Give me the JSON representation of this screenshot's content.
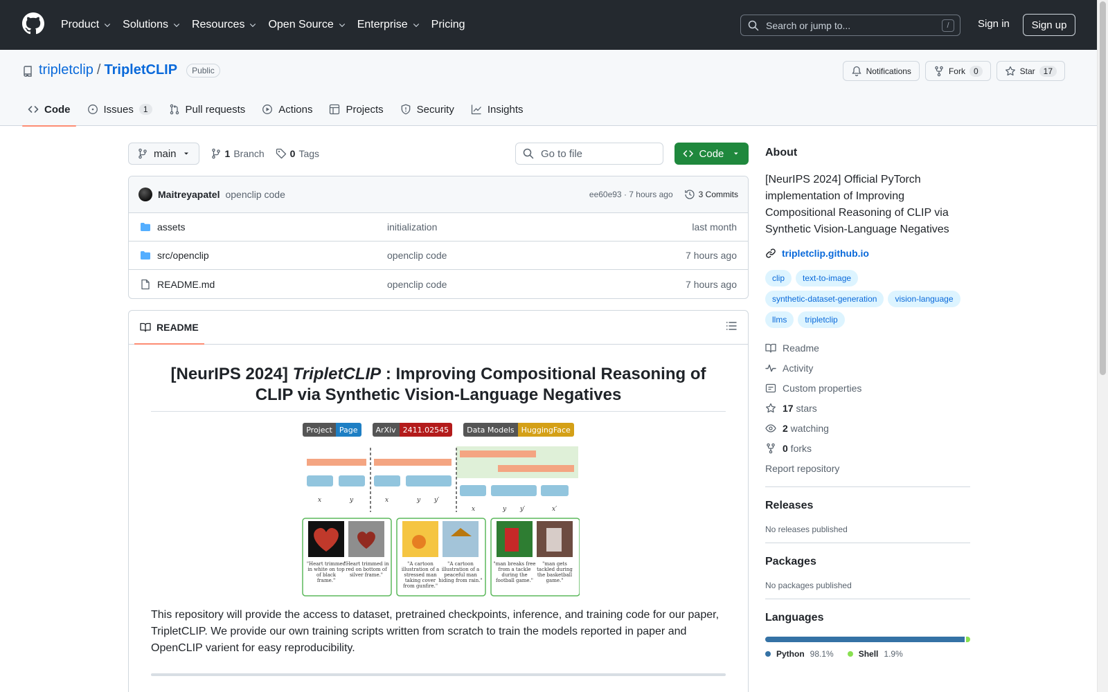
{
  "header": {
    "nav": [
      {
        "label": "Product",
        "dropdown": true
      },
      {
        "label": "Solutions",
        "dropdown": true
      },
      {
        "label": "Resources",
        "dropdown": true
      },
      {
        "label": "Open Source",
        "dropdown": true
      },
      {
        "label": "Enterprise",
        "dropdown": true
      },
      {
        "label": "Pricing",
        "dropdown": false
      }
    ],
    "search_placeholder": "Search or jump to...",
    "search_shortcut": "/",
    "sign_in": "Sign in",
    "sign_up": "Sign up"
  },
  "repo": {
    "owner": "tripletclip",
    "separator": "/",
    "name": "TripletCLIP",
    "visibility": "Public",
    "notifications_label": "Notifications",
    "fork_label": "Fork",
    "fork_count": "0",
    "star_label": "Star",
    "star_count": "17",
    "tabs": [
      {
        "label": "Code",
        "icon": "code-icon",
        "active": true,
        "count": ""
      },
      {
        "label": "Issues",
        "icon": "issue-icon",
        "active": false,
        "count": "1"
      },
      {
        "label": "Pull requests",
        "icon": "pull-request-icon",
        "active": false,
        "count": ""
      },
      {
        "label": "Actions",
        "icon": "play-icon",
        "active": false,
        "count": ""
      },
      {
        "label": "Projects",
        "icon": "table-icon",
        "active": false,
        "count": ""
      },
      {
        "label": "Security",
        "icon": "shield-icon",
        "active": false,
        "count": ""
      },
      {
        "label": "Insights",
        "icon": "graph-icon",
        "active": false,
        "count": ""
      }
    ]
  },
  "file_nav": {
    "branch": "main",
    "branch_count": "1",
    "branch_label": "Branch",
    "tag_count": "0",
    "tag_label": "Tags",
    "goto_placeholder": "Go to file",
    "code_button": "Code"
  },
  "last_commit": {
    "author": "Maitreyapatel",
    "message": "openclip code",
    "hash_time": "ee60e93 · 7 hours ago",
    "commits_label": "3 Commits"
  },
  "files": [
    {
      "name": "assets",
      "type": "folder",
      "commit": "initialization",
      "age": "last month"
    },
    {
      "name": "src/openclip",
      "type": "folder",
      "commit": "openclip code",
      "age": "7 hours ago"
    },
    {
      "name": "README.md",
      "type": "file",
      "commit": "openclip code",
      "age": "7 hours ago"
    }
  ],
  "readme": {
    "tab_label": "README",
    "title_prefix": "[NeurIPS 2024] ",
    "title_italic": "TripletCLIP",
    "title_rest": " : Improving Compositional Reasoning of CLIP via Synthetic Vision-Language Negatives",
    "badges": [
      {
        "left": "Project",
        "right": "Page",
        "color": "#1e7fc4"
      },
      {
        "left": "ArXiv",
        "right": "2411.02545",
        "color": "#b31b1b"
      },
      {
        "left": "Data Models",
        "right": "HuggingFace",
        "color": "#d4a017"
      }
    ],
    "paragraph": "This repository will provide the access to dataset, pretrained checkpoints, inference, and training code for our paper, TripletCLIP. We provide our own training scripts written from scratch to train the models reported in paper and OpenCLIP varient for easy reproducibility."
  },
  "about": {
    "title": "About",
    "description": "[NeurIPS 2024] Official PyTorch implementation of Improving Compositional Reasoning of CLIP via Synthetic Vision-Language Negatives",
    "homepage": "tripletclip.github.io",
    "topics": [
      "clip",
      "text-to-image",
      "synthetic-dataset-generation",
      "vision-language",
      "llms",
      "tripletclip"
    ],
    "links": [
      {
        "icon": "book-icon",
        "bold": "",
        "text": "Readme"
      },
      {
        "icon": "pulse-icon",
        "bold": "",
        "text": "Activity"
      },
      {
        "icon": "note-icon",
        "bold": "",
        "text": "Custom properties"
      },
      {
        "icon": "star-icon",
        "bold": "17",
        "text": " stars"
      },
      {
        "icon": "eye-icon",
        "bold": "2",
        "text": " watching"
      },
      {
        "icon": "fork-icon",
        "bold": "0",
        "text": " forks"
      }
    ],
    "report": "Report repository"
  },
  "releases": {
    "title": "Releases",
    "empty": "No releases published"
  },
  "packages": {
    "title": "Packages",
    "empty": "No packages published"
  },
  "languages": {
    "title": "Languages",
    "items": [
      {
        "name": "Python",
        "percent": "98.1%",
        "value": 98.1,
        "color": "#3572A5"
      },
      {
        "name": "Shell",
        "percent": "1.9%",
        "value": 1.9,
        "color": "#89e051"
      }
    ]
  },
  "colors": {
    "accent": "#0969da",
    "header_bg": "#24292f",
    "code_button": "#1f883d",
    "tab_underline": "#fd8c73"
  }
}
